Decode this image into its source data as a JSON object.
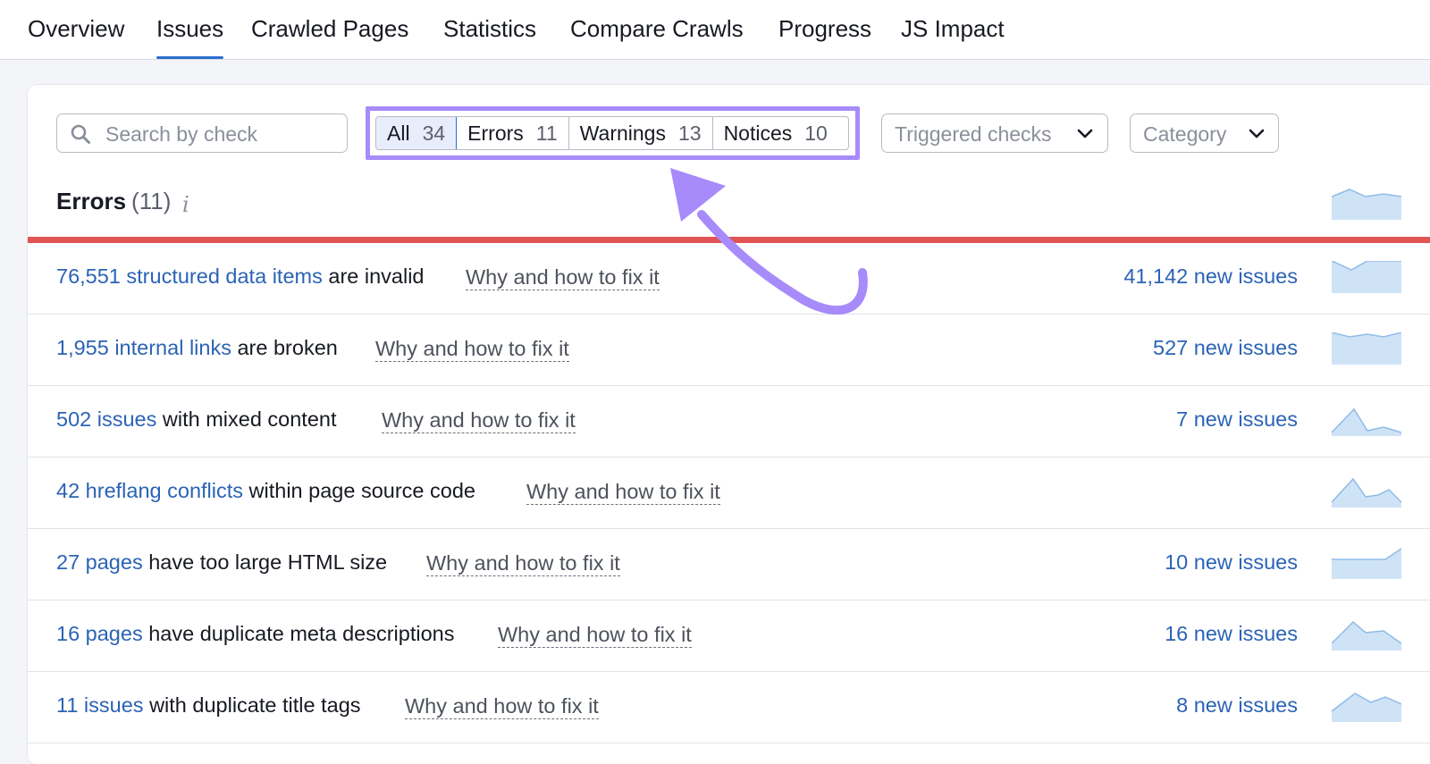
{
  "nav": {
    "tabs": [
      {
        "label": "Overview"
      },
      {
        "label": "Issues"
      },
      {
        "label": "Crawled Pages"
      },
      {
        "label": "Statistics"
      },
      {
        "label": "Compare Crawls"
      },
      {
        "label": "Progress"
      },
      {
        "label": "JS Impact"
      }
    ],
    "active": "Issues"
  },
  "search": {
    "placeholder": "Search by check",
    "value": ""
  },
  "filters": [
    {
      "label": "All",
      "count": "34"
    },
    {
      "label": "Errors",
      "count": "11"
    },
    {
      "label": "Warnings",
      "count": "13"
    },
    {
      "label": "Notices",
      "count": "10"
    }
  ],
  "dropdowns": {
    "triggered": "Triggered checks",
    "category": "Category"
  },
  "errors_section": {
    "title": "Errors",
    "count": "(11)",
    "info": "i"
  },
  "rows": [
    {
      "link": "76,551 structured data items",
      "text": " are invalid",
      "fix": "Why and how to fix it",
      "new": "41,142 new issues"
    },
    {
      "link": "1,955 internal links",
      "text": " are broken",
      "fix": "Why and how to fix it",
      "new": "527 new issues"
    },
    {
      "link": "502 issues",
      "text": " with mixed content",
      "fix": "Why and how to fix it",
      "new": "7 new issues"
    },
    {
      "link": "42 hreflang conflicts",
      "text": " within page source code",
      "fix": "Why and how to fix it",
      "new": ""
    },
    {
      "link": "27 pages",
      "text": " have too large HTML size",
      "fix": "Why and how to fix it",
      "new": "10 new issues"
    },
    {
      "link": "16 pages",
      "text": " have duplicate meta descriptions",
      "fix": "Why and how to fix it",
      "new": "16 new issues"
    },
    {
      "link": "11 issues",
      "text": " with duplicate title tags",
      "fix": "Why and how to fix it",
      "new": "8 new issues"
    }
  ],
  "colors": {
    "accent": "#2b6fcf",
    "link": "#2b63b5",
    "error_bar": "#e05456",
    "highlight": "#a78bfa",
    "sparkline": "#cfe3f7"
  }
}
